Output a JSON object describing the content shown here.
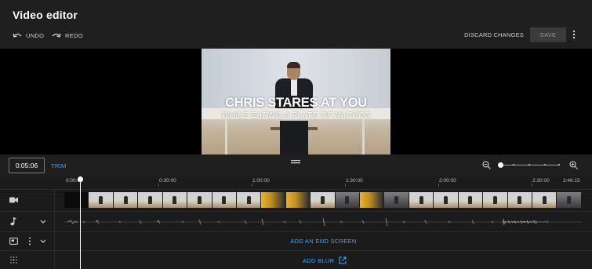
{
  "header": {
    "title": "Video editor",
    "undo_label": "UNDO",
    "redo_label": "REDO",
    "discard_label": "DISCARD CHANGES",
    "save_label": "SAVE"
  },
  "preview": {
    "line1": "CHRIS STARES AT YOU",
    "line2": "WHILE EATING A PLATE OF NACHOS"
  },
  "toolbar": {
    "current_time": "0:05:06",
    "trim_label": "TRIM",
    "zoom_level": 0.0
  },
  "ruler": {
    "labels": [
      "0:00:00",
      "0:30:00",
      "1:00:00",
      "1:30:00",
      "2:00:00",
      "2:30:00",
      "2:46:15"
    ]
  },
  "tracks": {
    "end_screen_label": "ADD AN END SCREEN",
    "blur_label": "ADD BLUR"
  },
  "icons": {
    "undo": "undo-icon",
    "redo": "redo-icon",
    "more": "more-vert-icon",
    "zoom_out": "zoom-out-icon",
    "zoom_in": "zoom-in-icon",
    "video_track": "videocam-icon",
    "audio_track": "music-note-icon",
    "end_screen_track": "end-screen-icon",
    "blur_track": "blur-icon",
    "open_external": "open-in-new-icon"
  },
  "colors": {
    "accent": "#3ea6ff",
    "header_bg": "#1f1f1f",
    "save_bg": "#3b3b3b"
  }
}
